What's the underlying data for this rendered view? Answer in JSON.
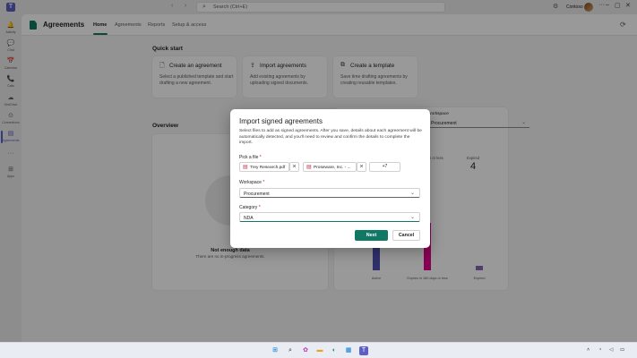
{
  "titlebar": {
    "search_placeholder": "Search (Ctrl+E)",
    "org": "Contoso",
    "win_more": "···",
    "win_min": "–",
    "win_max": "▢",
    "win_close": "✕"
  },
  "rail": [
    {
      "label": "Activity",
      "icon": "bell-icon",
      "glyph": "🔔"
    },
    {
      "label": "Chat",
      "icon": "chat-icon",
      "glyph": "💬"
    },
    {
      "label": "Calendar",
      "icon": "calendar-icon",
      "glyph": "📅"
    },
    {
      "label": "Calls",
      "icon": "phone-icon",
      "glyph": "📞"
    },
    {
      "label": "OneDrive",
      "icon": "cloud-icon",
      "glyph": "☁"
    },
    {
      "label": "Connections",
      "icon": "connections-icon",
      "glyph": "⊙"
    },
    {
      "label": "Agreements",
      "icon": "agreements-icon",
      "glyph": "▤"
    },
    {
      "label": "",
      "icon": "more-icon",
      "glyph": "···"
    },
    {
      "label": "Apps",
      "icon": "apps-icon",
      "glyph": "⊞"
    }
  ],
  "app": {
    "title": "Agreements",
    "tabs": [
      "Home",
      "Agreements",
      "Reports",
      "Setup & access"
    ],
    "active_tab": "Home"
  },
  "quick_start": {
    "title": "Quick start",
    "cards": [
      {
        "title": "Create an agreement",
        "desc": "Select a published template and start drafting a new agreement.",
        "icon": "document-icon",
        "glyph": "🗋"
      },
      {
        "title": "Import agreements",
        "desc": "Add existing agreements by uploading signed documents.",
        "icon": "upload-icon",
        "glyph": "⇪"
      },
      {
        "title": "Create a template",
        "desc": "Save time drafting agreements by creating reusable templates.",
        "icon": "template-icon",
        "glyph": "⧉"
      }
    ]
  },
  "overview": {
    "title": "Overview",
    "empty_title": "Not enough data",
    "empty_sub": "There are no in-progress agreements.",
    "workspace_label": "Workspace",
    "workspace_value": "Procurement",
    "kpis": [
      {
        "label": "Expires in 180 days or less",
        "label_visible": "ys or less",
        "value": ""
      },
      {
        "label": "Expired",
        "value": "4"
      }
    ],
    "chart_data": {
      "type": "bar",
      "categories": [
        "Active",
        "Expires in 180 days or less",
        "Expired"
      ],
      "values": [
        55,
        53,
        5
      ],
      "colors": [
        "#4f52b2",
        "#e3008c",
        "#8764b8"
      ]
    }
  },
  "dialog": {
    "title": "Import signed agreements",
    "description": "Select files to add as signed agreements. After you save, details about each agreement will be automatically detected, and you'll need to review and confirm the details to complete the import.",
    "file_label": "Pick a file",
    "required_mark": "*",
    "files": [
      "Trey Research.pdf",
      "Proseware, Inc. - ..."
    ],
    "more_files": "+7",
    "workspace_label": "Workspace",
    "workspace_value": "Procurement",
    "category_label": "Category",
    "category_value": "NDA",
    "next_label": "Next",
    "cancel_label": "Cancel",
    "colors": {
      "accent": "#117865",
      "required": "#c50f1f"
    }
  },
  "taskbar": {
    "time": "",
    "icons": [
      "windows-icon",
      "search-icon",
      "copilot-icon",
      "file-explorer-icon",
      "edge-icon",
      "store-icon",
      "teams-icon"
    ]
  }
}
